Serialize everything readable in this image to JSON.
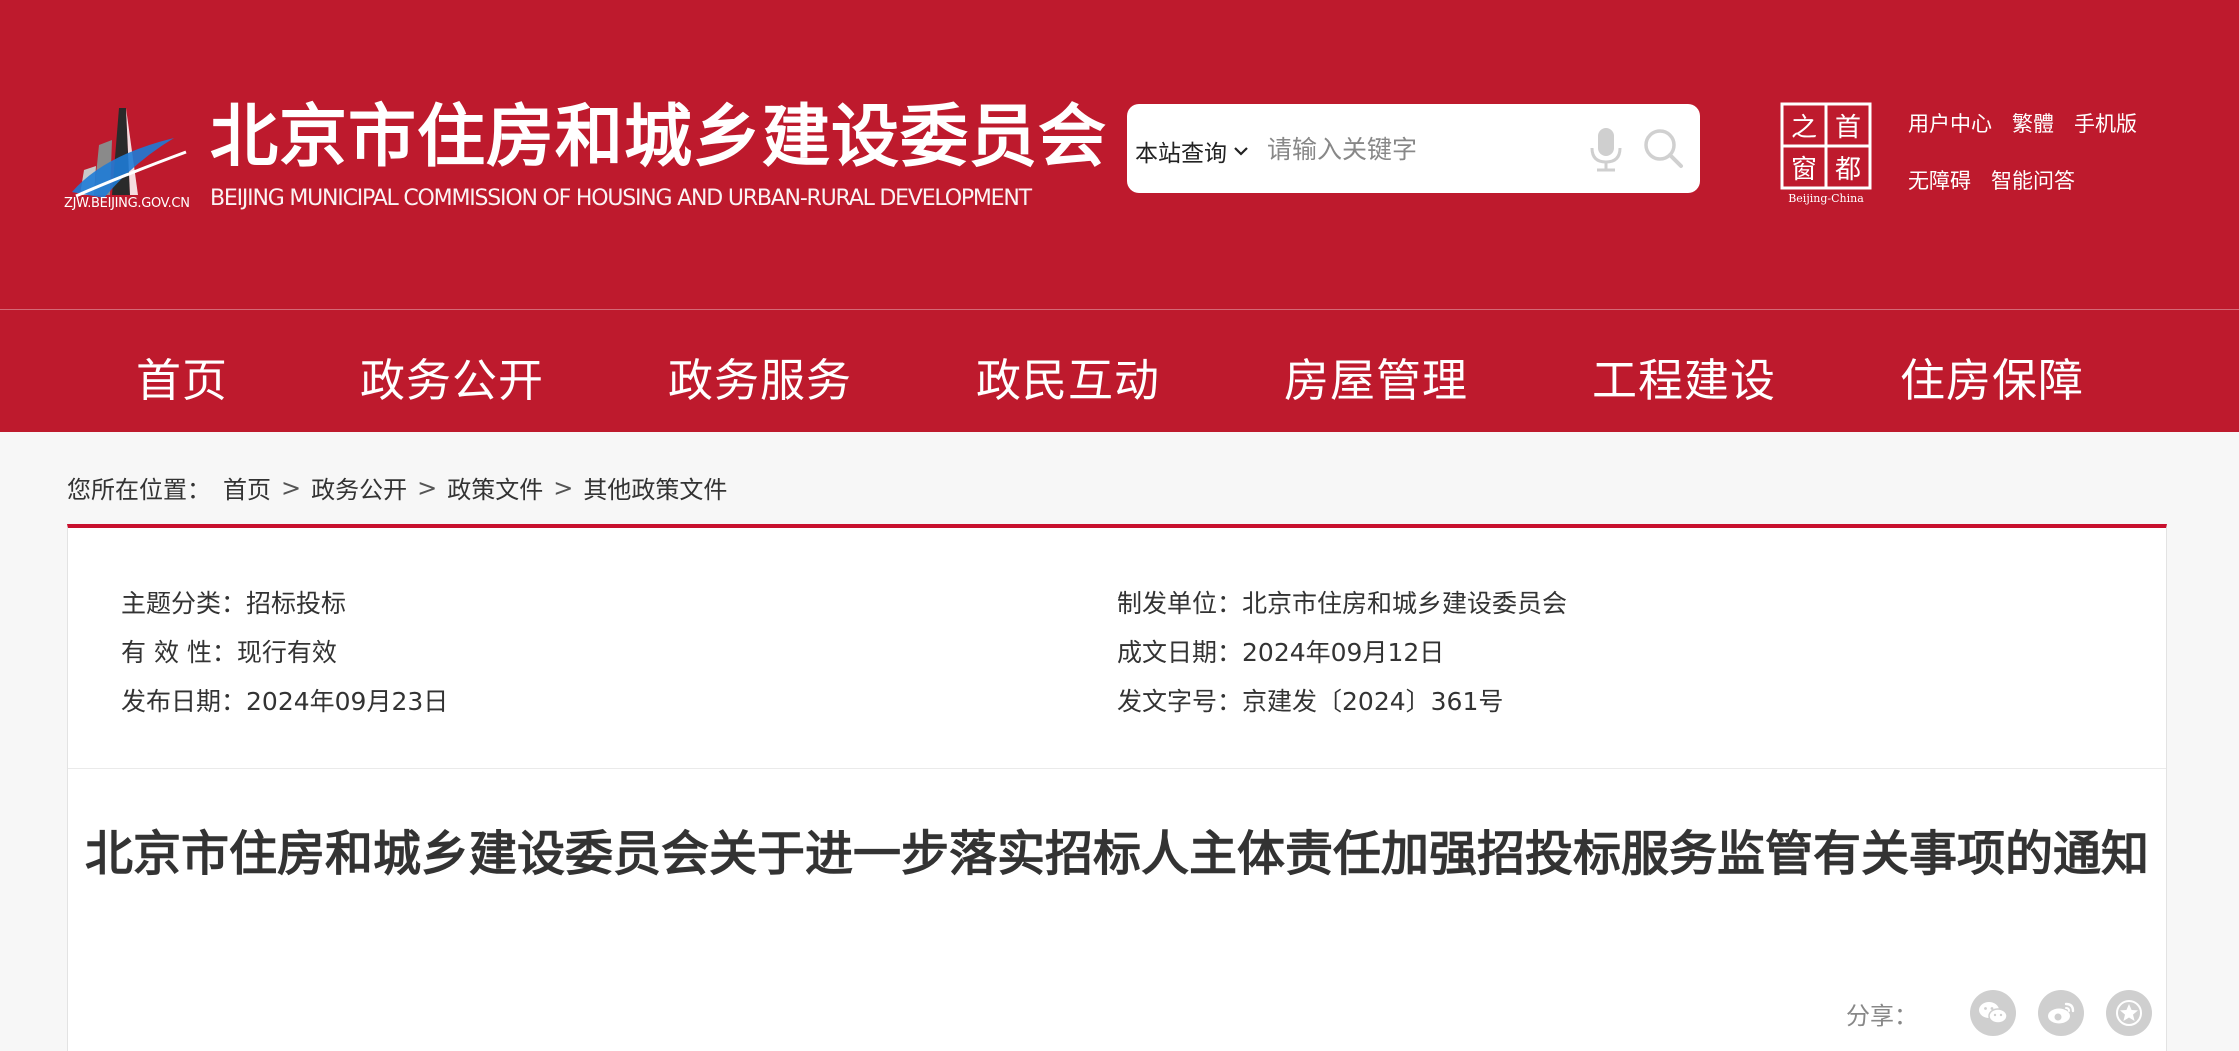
{
  "header": {
    "logo_url_text": "ZJW.BEIJING.GOV.CN",
    "site_title": "北京市住房和城乡建设委员会",
    "site_subtitle": "BEIJING MUNICIPAL COMMISSION OF HOUSING AND URBAN-RURAL DEVELOPMENT",
    "search": {
      "scope_label": "本站查询",
      "placeholder": "请输入关键字"
    },
    "capital_logo_chars": [
      "首",
      "都",
      "之",
      "窗"
    ],
    "capital_logo_caption": "Beijing-China",
    "top_links_row1": [
      "用户中心",
      "繁體",
      "手机版"
    ],
    "top_links_row2": [
      "无障碍",
      "智能问答"
    ]
  },
  "nav": {
    "items": [
      "首页",
      "政务公开",
      "政务服务",
      "政民互动",
      "房屋管理",
      "工程建设",
      "住房保障"
    ]
  },
  "breadcrumb": {
    "prefix": "您所在位置：",
    "items": [
      "首页",
      "政务公开",
      "政策文件",
      "其他政策文件"
    ],
    "separator": ">"
  },
  "meta": {
    "topic_label": "主题分类：",
    "topic_value": "招标投标",
    "validity_label": "有 效 性：",
    "validity_value": "现行有效",
    "publish_date_label": "发布日期：",
    "publish_date_value": "2024年09月23日",
    "issuer_label": "制发单位：",
    "issuer_value": "北京市住房和城乡建设委员会",
    "written_date_label": "成文日期：",
    "written_date_value": "2024年09月12日",
    "doc_number_label": "发文字号：",
    "doc_number_value": "京建发〔2024〕361号"
  },
  "article": {
    "title": "北京市住房和城乡建设委员会关于进一步落实招标人主体责任加强招投标服务监管有关事项的通知"
  },
  "share": {
    "label": "分享：",
    "buttons": [
      "wechat-icon",
      "weibo-icon",
      "favorite-icon"
    ]
  },
  "colors": {
    "brand_red": "#be1a2d",
    "accent_red": "#c8102e"
  }
}
